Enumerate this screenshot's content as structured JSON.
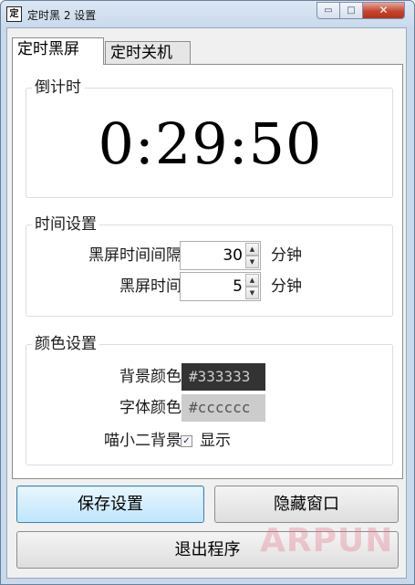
{
  "window": {
    "title": "定时黑 2 设置",
    "icon_glyph": "定",
    "min_glyph": "▭",
    "max_glyph": "□",
    "close_glyph": "✕"
  },
  "tabs": [
    {
      "label": "定时黑屏",
      "active": true
    },
    {
      "label": "定时关机",
      "active": false
    }
  ],
  "countdown": {
    "group_label": "倒计时",
    "value": "0:29:50"
  },
  "time_settings": {
    "group_label": "时间设置",
    "interval_label": "黑屏时间间隔",
    "interval_value": "30",
    "interval_unit": "分钟",
    "duration_label": "黑屏时间",
    "duration_value": "5",
    "duration_unit": "分钟",
    "spin_up_glyph": "▲",
    "spin_down_glyph": "▼"
  },
  "color_settings": {
    "group_label": "颜色设置",
    "bg_label": "背景颜色",
    "bg_value": "#333333",
    "fg_label": "字体颜色",
    "fg_value": "#cccccc",
    "cat_bg_label": "喵小二背景",
    "cat_bg_checkbox_label": "显示",
    "cat_bg_checked": true,
    "check_glyph": "✓"
  },
  "buttons": {
    "save": "保存设置",
    "hide": "隐藏窗口",
    "exit": "退出程序"
  },
  "watermark": "ARPUN"
}
